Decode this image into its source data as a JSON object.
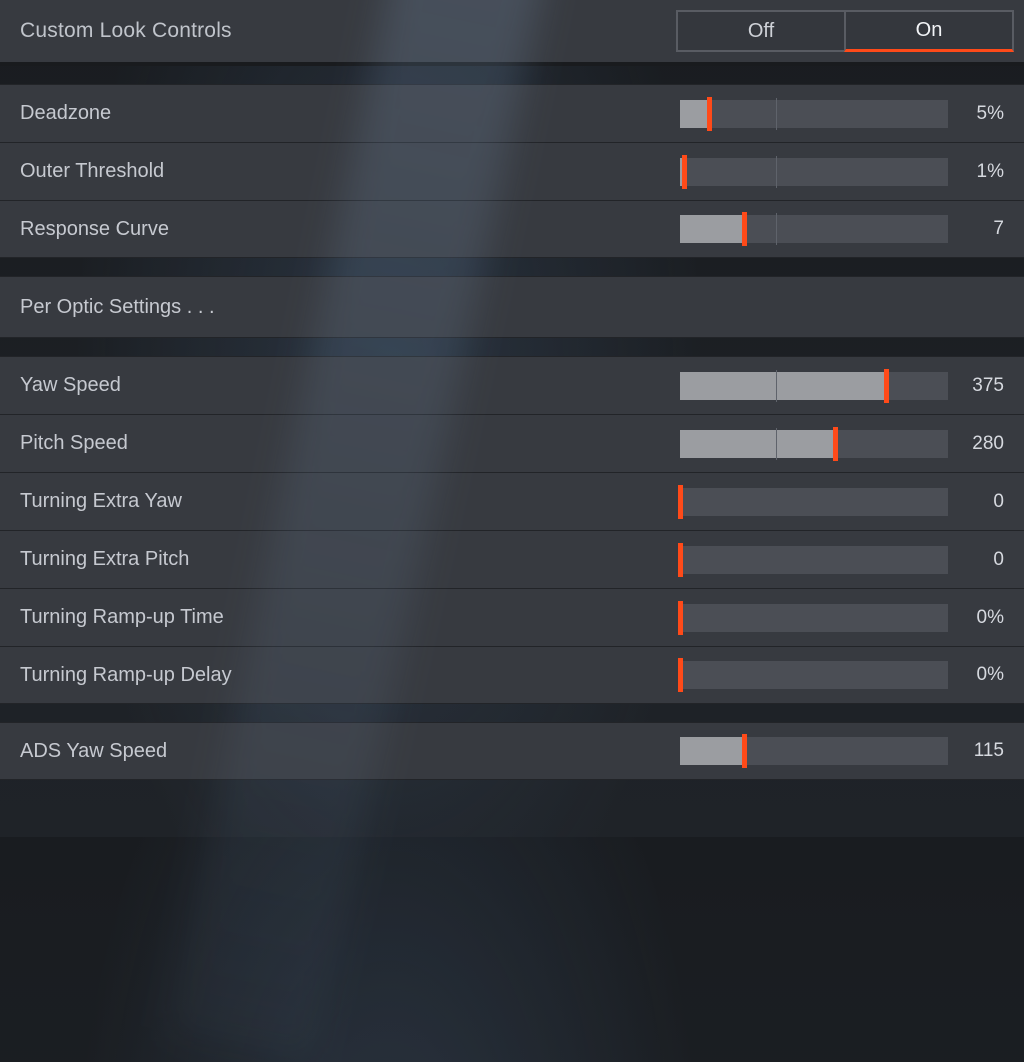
{
  "header": {
    "title": "Custom Look Controls",
    "toggle": {
      "off": "Off",
      "on": "On",
      "selected": "on"
    }
  },
  "groups": [
    {
      "type": "sliders",
      "items": [
        {
          "label": "Deadzone",
          "value": "5%",
          "fill_pct": 11,
          "handle_pct": 11,
          "tick_pct": 36
        },
        {
          "label": "Outer Threshold",
          "value": "1%",
          "fill_pct": 1.5,
          "handle_pct": 1.5,
          "tick_pct": 36
        },
        {
          "label": "Response Curve",
          "value": "7",
          "fill_pct": 24,
          "handle_pct": 24,
          "tick_pct": 36
        }
      ]
    },
    {
      "type": "subheader",
      "label": "Per Optic Settings . . ."
    },
    {
      "type": "sliders",
      "items": [
        {
          "label": "Yaw Speed",
          "value": "375",
          "fill_pct": 77,
          "handle_pct": 77,
          "tick_pct": 36
        },
        {
          "label": "Pitch Speed",
          "value": "280",
          "fill_pct": 58,
          "handle_pct": 58,
          "tick_pct": 36
        },
        {
          "label": "Turning Extra Yaw",
          "value": "0",
          "fill_pct": 0,
          "handle_pct": 0,
          "tick_pct": null
        },
        {
          "label": "Turning Extra Pitch",
          "value": "0",
          "fill_pct": 0,
          "handle_pct": 0,
          "tick_pct": null
        },
        {
          "label": "Turning Ramp-up Time",
          "value": "0%",
          "fill_pct": 0,
          "handle_pct": 0,
          "tick_pct": null
        },
        {
          "label": "Turning Ramp-up Delay",
          "value": "0%",
          "fill_pct": 0,
          "handle_pct": 0,
          "tick_pct": null
        }
      ]
    },
    {
      "type": "sliders",
      "items": [
        {
          "label": "ADS Yaw Speed",
          "value": "115",
          "fill_pct": 24,
          "handle_pct": 24,
          "tick_pct": null
        }
      ]
    }
  ]
}
